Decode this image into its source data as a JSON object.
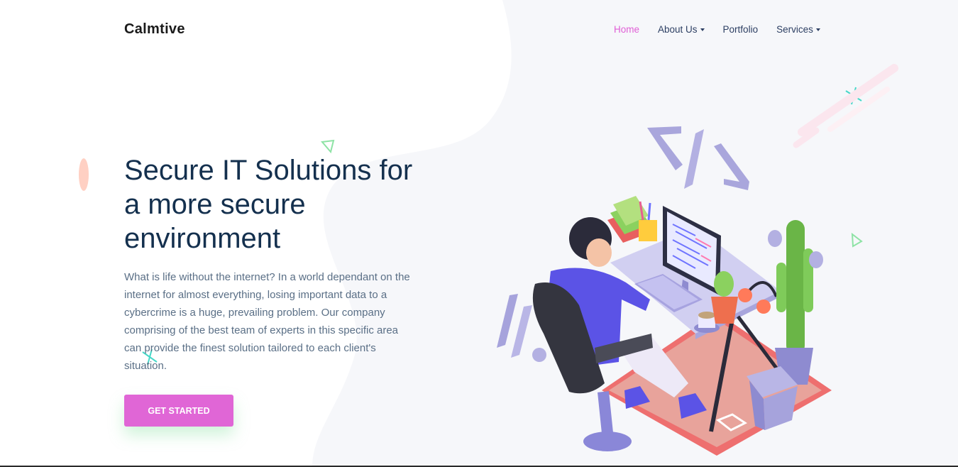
{
  "brand": {
    "name": "Calmtive"
  },
  "nav": {
    "items": [
      {
        "label": "Home",
        "active": true,
        "dropdown": false
      },
      {
        "label": "About Us",
        "active": false,
        "dropdown": true
      },
      {
        "label": "Portfolio",
        "active": false,
        "dropdown": false
      },
      {
        "label": "Services",
        "active": false,
        "dropdown": true
      }
    ]
  },
  "hero": {
    "title": "Secure IT Solutions for a more secure environment",
    "description": "What is life without the internet? In a world dependant on the internet for almost everything, losing important data to a cybercrime is a huge, prevailing problem. Our company comprising of the best team of experts in this specific area can provide the finest solution tailored to each client's situation.",
    "cta_label": "GET STARTED"
  },
  "colors": {
    "accent": "#e066d6",
    "heading": "#14304e",
    "body_text": "#5a6f86",
    "nav_text": "#2c3e62"
  },
  "icons": [
    "caret-down-icon",
    "cross-decoration-icon",
    "triangle-decoration-icon",
    "code-brackets-icon"
  ]
}
